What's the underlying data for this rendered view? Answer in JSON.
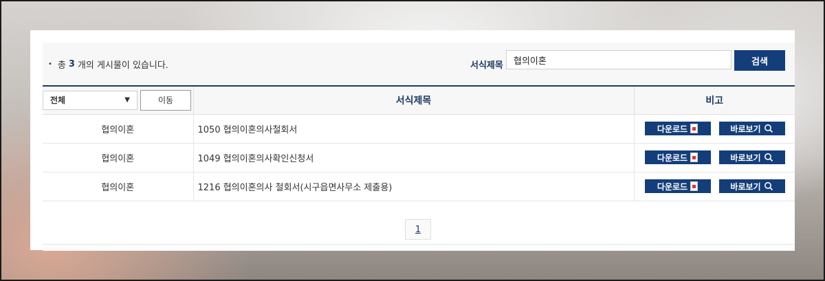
{
  "summary": {
    "prefix": "총",
    "count": "3",
    "suffix": "개의 게시물이 있습니다."
  },
  "search": {
    "label": "서식제목",
    "value": "협의이혼",
    "button": "검색"
  },
  "filter": {
    "selected": "전체",
    "move_button": "이동"
  },
  "table": {
    "headers": {
      "title": "서식제목",
      "remarks": "비고"
    },
    "rows": [
      {
        "category": "협의이혼",
        "title": "1050 협의이혼의사철회서",
        "download": "다운로드",
        "view": "바로보기"
      },
      {
        "category": "협의이혼",
        "title": "1049 협의이혼의사확인신청서",
        "download": "다운로드",
        "view": "바로보기"
      },
      {
        "category": "협의이혼",
        "title": "1216 협의이혼의사 철회서(시구읍면사무소 제출용)",
        "download": "다운로드",
        "view": "바로보기"
      }
    ]
  },
  "pagination": {
    "current": "1"
  },
  "colors": {
    "accent": "#133e7a"
  }
}
